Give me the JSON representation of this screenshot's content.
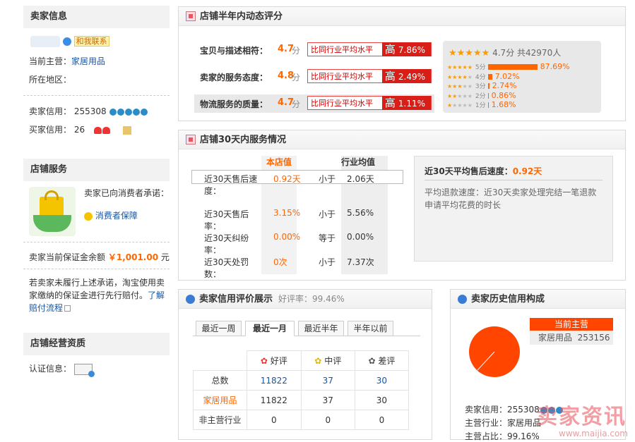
{
  "seller_info": {
    "title": "卖家信息",
    "contact": "和我联系",
    "main_business_label": "当前主营：",
    "main_business": "家居用品",
    "region_label": "所在地区：",
    "seller_credit_label": "卖家信用：",
    "seller_credit": "255308",
    "buyer_credit_label": "买家信用：",
    "buyer_credit": "26"
  },
  "shop_service": {
    "title": "店铺服务",
    "promise": "卖家已向消费者承诺：",
    "guarantee": "消费者保障",
    "deposit_label": "卖家当前保证金余额",
    "deposit_value": "￥1,001.00",
    "deposit_unit": "元",
    "note": "若卖家未履行上述承诺，淘宝使用卖家缴纳的保证金进行先行赔付。",
    "link1": "了解",
    "link2": "赔付流程"
  },
  "qualification": {
    "title": "店铺经营资质",
    "cert_label": "认证信息："
  },
  "dsr": {
    "title": "店铺半年内动态评分",
    "items": [
      {
        "label": "宝贝与描述相符：",
        "score": "4.7",
        "unit": "分",
        "compare": "比同行业平均水平",
        "level": "高",
        "pct": "7.86%"
      },
      {
        "label": "卖家的服务态度：",
        "score": "4.8",
        "unit": "分",
        "compare": "比同行业平均水平",
        "level": "高",
        "pct": "2.49%"
      },
      {
        "label": "物流服务的质量：",
        "score": "4.7",
        "unit": "分",
        "compare": "比同行业平均水平",
        "level": "高",
        "pct": "1.11%"
      }
    ],
    "summary_score": "4.7分",
    "summary_count": "共42970人",
    "dist": [
      {
        "label": "5分",
        "pct": "87.69%",
        "value": 87.69
      },
      {
        "label": "4分",
        "pct": "7.02%",
        "value": 7.02
      },
      {
        "label": "3分",
        "pct": "2.74%",
        "value": 2.74
      },
      {
        "label": "2分",
        "pct": "0.86%",
        "value": 0.86
      },
      {
        "label": "1分",
        "pct": "1.68%",
        "value": 1.68
      }
    ]
  },
  "service30": {
    "title": "店铺30天内服务情况",
    "col_shop": "本店值",
    "col_avg": "行业均值",
    "rows": [
      {
        "label": "近30天售后速度：",
        "shop": "0.92天",
        "cmp": "小于",
        "avg": "2.06天"
      },
      {
        "label": "近30天售后率：",
        "shop": "3.15%",
        "cmp": "小于",
        "avg": "5.56%"
      },
      {
        "label": "近30天纠纷率：",
        "shop": "0.00%",
        "cmp": "等于",
        "avg": "0.00%"
      },
      {
        "label": "近30天处罚数：",
        "shop": "0次",
        "cmp": "小于",
        "avg": "7.37次"
      }
    ],
    "tip_title": "近30天平均售后速度：",
    "tip_value": "0.92天",
    "tip_desc": "平均退款速度：近30天卖家处理完结一笔退款申请平均花费的时长"
  },
  "credit_eval": {
    "title": "卖家信用评价展示",
    "good_rate": "好评率：99.46%",
    "tabs": [
      "最近一周",
      "最近一月",
      "最近半年",
      "半年以前"
    ],
    "headers": [
      "好评",
      "中评",
      "差评"
    ],
    "rows": [
      {
        "label": "总数",
        "good": "11822",
        "mid": "37",
        "bad": "30"
      },
      {
        "label": "家居用品",
        "good": "11822",
        "mid": "37",
        "bad": "30"
      },
      {
        "label": "非主营行业",
        "good": "0",
        "mid": "0",
        "bad": "0"
      }
    ]
  },
  "credit_history": {
    "title": "卖家历史信用构成",
    "tag": "当前主营",
    "tag_item": "家居用品",
    "tag_value": "253156",
    "seller_credit": "卖家信用：255308",
    "main_industry": "主营行业：家居用品",
    "main_ratio": "主营占比：99.16%"
  },
  "watermark": {
    "text": "卖家资讯",
    "url": "www.maijia.com"
  },
  "colors": {
    "accent": "#ff6600",
    "red": "#d91e18",
    "link": "#1a55a0"
  }
}
